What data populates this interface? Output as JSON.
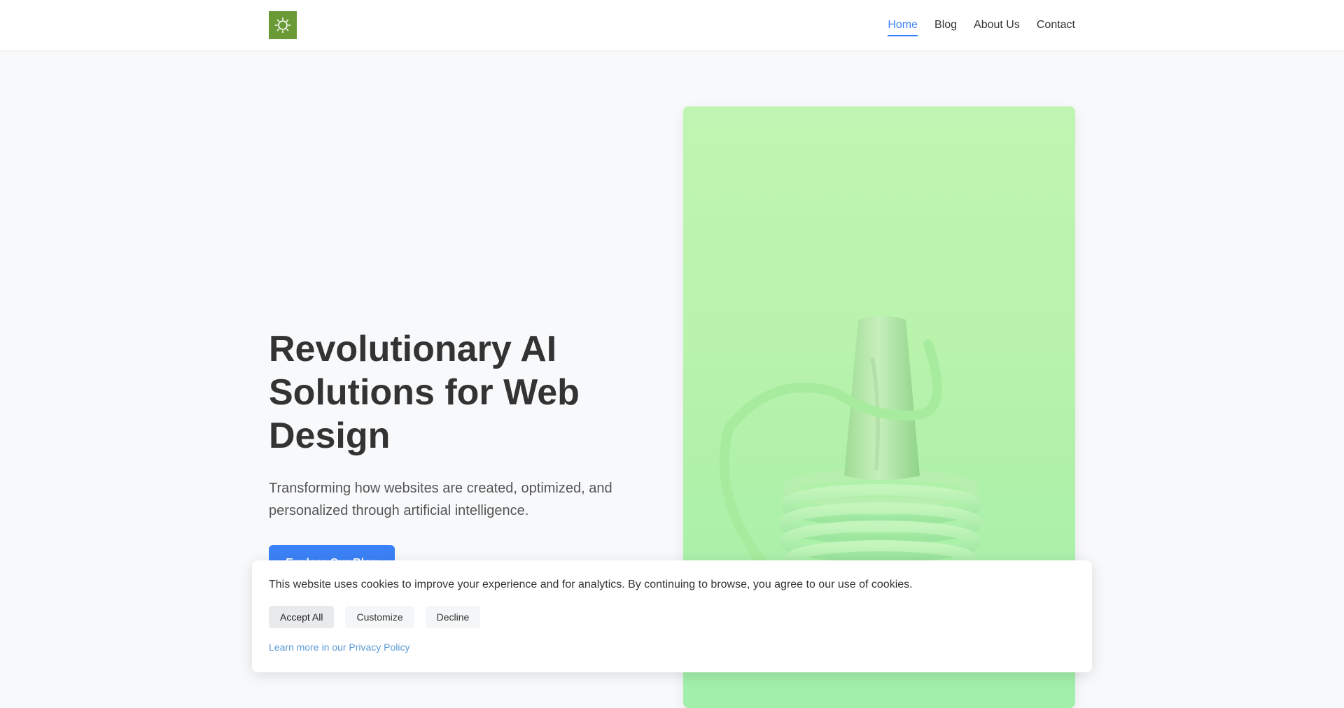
{
  "header": {
    "logo_icon": "sun-gear-icon",
    "logo_color": "#6a9a36",
    "nav": [
      {
        "label": "Home",
        "active": true
      },
      {
        "label": "Blog",
        "active": false
      },
      {
        "label": "About Us",
        "active": false
      },
      {
        "label": "Contact",
        "active": false
      }
    ],
    "active_color": "#3b82f6"
  },
  "hero": {
    "title": "Revolutionary AI Solutions for Web Design",
    "subtitle": "Transforming how websites are created, optimized, and personalized through artificial intelligence.",
    "cta_label": "Explore Our Blog",
    "cta_color": "#3b82f6",
    "image_tint": "#b8f3ab"
  },
  "cookie_banner": {
    "message": "This website uses cookies to improve your experience and for analytics. By continuing to browse, you agree to our use of cookies.",
    "accept_label": "Accept All",
    "customize_label": "Customize",
    "decline_label": "Decline",
    "privacy_link": "Learn more in our Privacy Policy",
    "link_color": "#5b9bd5"
  }
}
